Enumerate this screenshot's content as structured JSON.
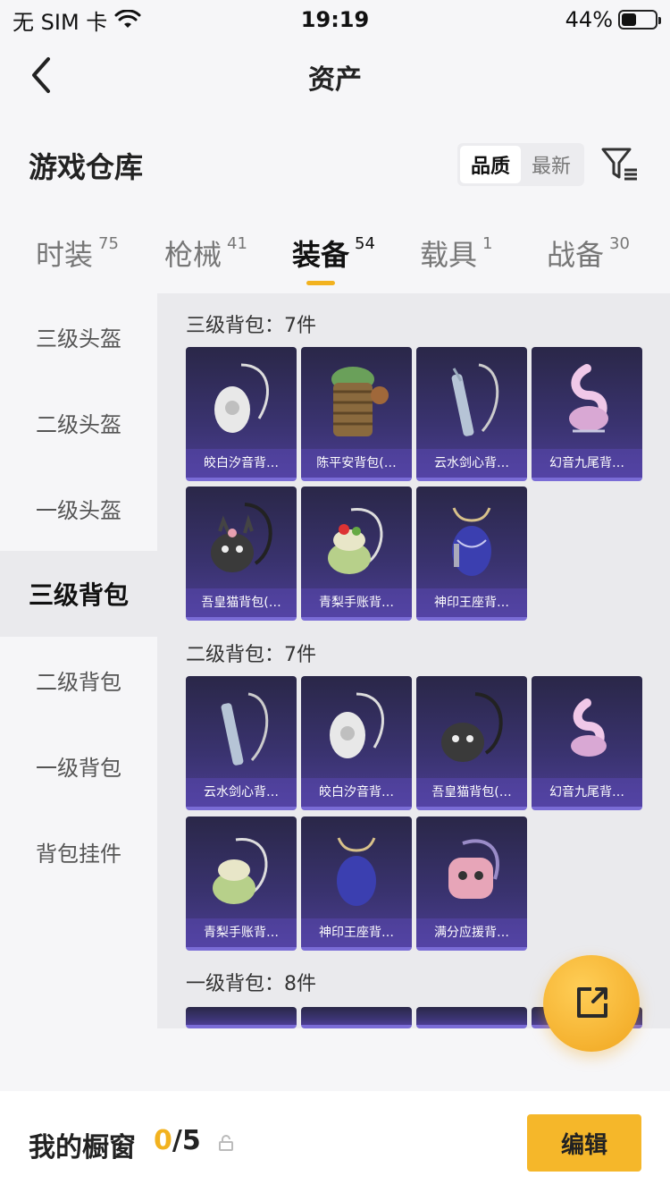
{
  "status": {
    "carrier": "无 SIM 卡",
    "time": "19:19",
    "battery": "44%",
    "battery_level": 0.44
  },
  "nav": {
    "title": "资产"
  },
  "section": {
    "title": "游戏仓库",
    "sort_quality": "品质",
    "sort_latest": "最新"
  },
  "tabs": [
    {
      "label": "时装",
      "count": "75"
    },
    {
      "label": "枪械",
      "count": "41"
    },
    {
      "label": "装备",
      "count": "54"
    },
    {
      "label": "载具",
      "count": "1"
    },
    {
      "label": "战备",
      "count": "30"
    }
  ],
  "sidebar": [
    "三级头盔",
    "二级头盔",
    "一级头盔",
    "三级背包",
    "二级背包",
    "一级背包",
    "背包挂件"
  ],
  "groups": [
    {
      "title": "三级背包：7件",
      "items": [
        "皎白汐音背…",
        "陈平安背包(…",
        "云水剑心背…",
        "幻音九尾背…",
        "吾皇猫背包(…",
        "青梨手账背…",
        "神印王座背…"
      ]
    },
    {
      "title": "二级背包：7件",
      "items": [
        "云水剑心背…",
        "皎白汐音背…",
        "吾皇猫背包(…",
        "幻音九尾背…",
        "青梨手账背…",
        "神印王座背…",
        "满分应援背…"
      ]
    },
    {
      "title": "一级背包：8件"
    }
  ],
  "showcase": {
    "label": "我的橱窗",
    "current": "0",
    "sep": "/",
    "max": "5",
    "edit": "编辑"
  },
  "colors": {
    "accent": "#f2b21f",
    "card_top": "#2a2748",
    "card_bottom": "#4b3d92"
  },
  "icons": {
    "back": "chevron-left-icon",
    "filter": "filter-icon",
    "share": "share-external-icon",
    "lock": "lock-icon"
  }
}
